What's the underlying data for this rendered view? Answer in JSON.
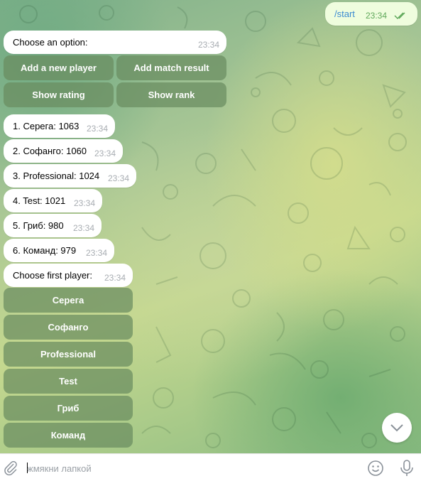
{
  "outgoing": {
    "text": "/start",
    "time": "23:34"
  },
  "menu_prompt": {
    "text": "Choose an option:",
    "time": "23:34"
  },
  "menu_buttons": [
    "Add a new player",
    "Add match result",
    "Show rating",
    "Show rank"
  ],
  "rating": [
    {
      "text": "1. Серега: 1063",
      "time": "23:34"
    },
    {
      "text": "2. Софанго: 1060",
      "time": "23:34"
    },
    {
      "text": "3. Professional: 1024",
      "time": "23:34"
    },
    {
      "text": "4. Test: 1021",
      "time": "23:34"
    },
    {
      "text": "5. Гриб: 980",
      "time": "23:34"
    },
    {
      "text": "6. Команд: 979",
      "time": "23:34"
    }
  ],
  "choose_prompt": {
    "text": "Choose first player:",
    "time": "23:34"
  },
  "player_buttons": [
    "Серега",
    "Софанго",
    "Professional",
    "Test",
    "Гриб",
    "Команд"
  ],
  "input": {
    "placeholder": "жмякни лапкой",
    "value": ""
  },
  "icons": {
    "attach": "paperclip-icon",
    "emoji": "smile-icon",
    "mic": "microphone-icon",
    "scroll": "chevron-down-icon",
    "read": "double-check-icon"
  },
  "colors": {
    "link": "#3a8ad1",
    "outgoing_bubble": "#effdde",
    "keyboard_button": "#698c5f"
  }
}
